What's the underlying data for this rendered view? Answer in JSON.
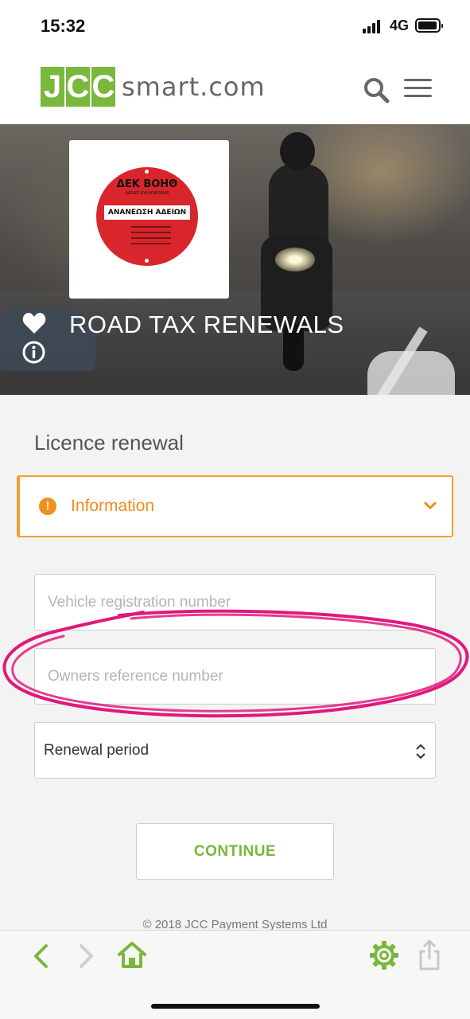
{
  "status_bar": {
    "time": "15:32",
    "network": "4G"
  },
  "header": {
    "logo_letters": [
      "J",
      "C",
      "C"
    ],
    "logo_text": "smart.com"
  },
  "hero": {
    "title": "ROAD TAX RENEWALS",
    "badge": {
      "top_text": "ΔΕΚ ΒΟΗΘ",
      "small_text": "ΑΔΕΙΕΣ ΚΥΚΛΟΦΟΡΙΑΣ",
      "label": "ΑΝΑΝΕΩΣΗ ΑΔΕΙΩΝ"
    }
  },
  "form": {
    "section_title": "Licence renewal",
    "info_label": "Information",
    "vehicle_placeholder": "Vehicle registration number",
    "owner_placeholder": "Owners reference number",
    "renewal_label": "Renewal period",
    "continue_label": "CONTINUE"
  },
  "footer": {
    "copyright": "© 2018 JCC Payment Systems Ltd"
  },
  "colors": {
    "brand_green": "#79b83b",
    "warning_orange": "#ef8c1c",
    "annotation_pink": "#e0197d"
  },
  "icons": [
    "search-icon",
    "menu-icon",
    "heart-icon",
    "info-icon",
    "warning-icon",
    "chevron-down-icon",
    "select-arrows-icon",
    "back-icon",
    "forward-icon",
    "home-icon",
    "settings-icon",
    "share-icon"
  ]
}
